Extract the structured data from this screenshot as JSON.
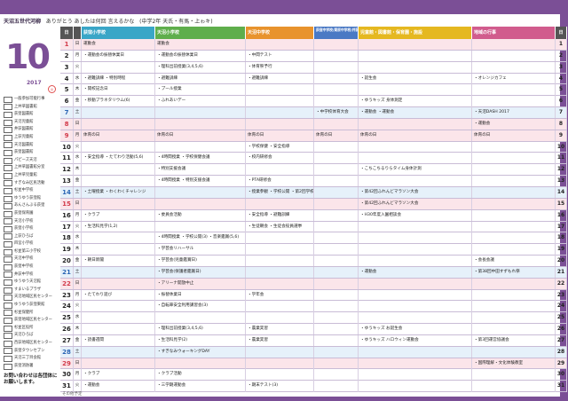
{
  "header": {
    "brand": "天沼五世代河柳",
    "greeting": "ありがとう あしたは何回 言えるかな",
    "note": "(中学2年 天氏・有馬・上ゎキ)"
  },
  "month": "10",
  "year": "2017",
  "legend": [
    {
      "sym": "",
      "label": "一般参加可能行事"
    },
    {
      "sym": "",
      "label": "上井草図書館"
    },
    {
      "sym": "",
      "label": "荻窪図書館"
    },
    {
      "sym": "",
      "label": "天沼児童館"
    },
    {
      "sym": "",
      "label": "井荻図書館"
    },
    {
      "sym": "",
      "label": "上荻児童館"
    },
    {
      "sym": "",
      "label": "天沼図書館"
    },
    {
      "sym": "",
      "label": "荻窪図書館"
    },
    {
      "sym": "",
      "label": "パピーズ天沼"
    },
    {
      "sym": "",
      "label": "上井草図書館分室"
    },
    {
      "sym": "",
      "label": "上井草児童館"
    },
    {
      "sym": "",
      "label": "すぎなみ区民活動"
    },
    {
      "sym": "",
      "label": "杉並中学校"
    },
    {
      "sym": "",
      "label": "ゆうゆう荻窪館"
    },
    {
      "sym": "",
      "label": "あんさんぶる荻窪"
    },
    {
      "sym": "",
      "label": "荻窪保育園"
    },
    {
      "sym": "",
      "label": "天沼小学校"
    },
    {
      "sym": "",
      "label": "荻窪小学校"
    },
    {
      "sym": "",
      "label": "上荻ひろば"
    },
    {
      "sym": "",
      "label": "四宮小学校"
    },
    {
      "sym": "",
      "label": "杉並第三小学校"
    },
    {
      "sym": "",
      "label": "天沼中学校"
    },
    {
      "sym": "",
      "label": "荻窪中学校"
    },
    {
      "sym": "",
      "label": "井荻中学校"
    },
    {
      "sym": "",
      "label": "ゆうゆう天沼館"
    },
    {
      "sym": "",
      "label": "すまいるプラザ"
    },
    {
      "sym": "",
      "label": "天沼地域区民センター"
    },
    {
      "sym": "",
      "label": "ゆうゆう荻窪東館"
    },
    {
      "sym": "",
      "label": "杉並保健所"
    },
    {
      "sym": "",
      "label": "荻窪地域区民センター"
    },
    {
      "sym": "",
      "label": "杉並区役所"
    },
    {
      "sym": "",
      "label": "天沼ひろば"
    },
    {
      "sym": "",
      "label": "西荻地域区民センター"
    },
    {
      "sym": "",
      "label": "荻窪タウンセブン"
    },
    {
      "sym": "",
      "label": "天沼三丁目会館"
    },
    {
      "sym": "",
      "label": "荻窪消防署"
    }
  ],
  "contact": "お問い合わせは各団体にお願いします。",
  "columns": [
    "日",
    "",
    "荻窪小学校",
    "天沼小学校",
    "天沼中学校",
    "荻窪中学校/東原中学校/井荻中学校",
    "児童館・図書館・保育園・施設",
    "地域の行事",
    "日"
  ],
  "days": [
    {
      "d": "1",
      "w": "日",
      "c1": "運動会",
      "c2": "運動会",
      "c3": "",
      "c4": "",
      "c5": "",
      "c6": "",
      "type": "sun"
    },
    {
      "d": "2",
      "w": "月",
      "c1": "・運動会の振替休業日",
      "c2": "・運動会の振替休業日",
      "c3": "・中間テスト",
      "c4": "",
      "c5": "",
      "c6": "",
      "type": ""
    },
    {
      "d": "3",
      "w": "火",
      "c1": "",
      "c2": "・理科出前授業(3,4,5,6)",
      "c3": "・体育祭予行",
      "c4": "",
      "c5": "",
      "c6": "",
      "type": ""
    },
    {
      "d": "4",
      "w": "水",
      "c1": "・避難訓練 ・特別時程",
      "c2": "・避難訓練",
      "c3": "・避難訓練",
      "c4": "",
      "c5": "・誕生会",
      "c6": "・オレンジカフェ",
      "type": ""
    },
    {
      "d": "5",
      "w": "木",
      "c1": "・開校記念日",
      "c2": "・プール授業",
      "c3": "",
      "c4": "",
      "c5": "",
      "c6": "",
      "type": ""
    },
    {
      "d": "6",
      "w": "金",
      "c1": "・移動プラネタリウム(6)",
      "c2": "・ふれあいデー",
      "c3": "",
      "c4": "",
      "c5": "・ゆうキッズ 身体測定",
      "c6": "",
      "type": ""
    },
    {
      "d": "7",
      "w": "土",
      "c1": "",
      "c2": "",
      "c3": "",
      "c4": "・中学校体育大会",
      "c5": "・運動会 ・運動会",
      "c6": "・天沼DASH 2017",
      "type": "sat"
    },
    {
      "d": "8",
      "w": "日",
      "c1": "",
      "c2": "",
      "c3": "",
      "c4": "",
      "c5": "",
      "c6": "・運動会",
      "type": "sun"
    },
    {
      "d": "9",
      "w": "月",
      "c1": "体育の日",
      "c2": "体育の日",
      "c3": "体育の日",
      "c4": "体育の日",
      "c5": "体育の日",
      "c6": "体育の日",
      "type": "sun"
    },
    {
      "d": "10",
      "w": "火",
      "c1": "",
      "c2": "",
      "c3": "・学校保健 ・安全指導",
      "c4": "",
      "c5": "",
      "c6": "",
      "type": ""
    },
    {
      "d": "11",
      "w": "水",
      "c1": "・安全指導 ・たてわり活動(5,6)",
      "c2": "・4時間授業 ・学校保健会議",
      "c3": "・校内研修会",
      "c4": "",
      "c5": "",
      "c6": "",
      "type": ""
    },
    {
      "d": "12",
      "w": "木",
      "c1": "",
      "c2": "・特別支援会議",
      "c3": "",
      "c4": "",
      "c5": "・こちこちるりらタイム身体計測",
      "c6": "",
      "type": ""
    },
    {
      "d": "13",
      "w": "金",
      "c1": "",
      "c2": "・4時間授業 ・特別支援会議",
      "c3": "・PTA研修会",
      "c4": "",
      "c5": "",
      "c6": "",
      "type": ""
    },
    {
      "d": "14",
      "w": "土",
      "c1": "・土曜授業 ・わくわくチャレンジ",
      "c2": "",
      "c3": "・授業参観 ・学校公開 ・第2回学校説明会",
      "c4": "",
      "c5": "・第42回ふれんどマラソン大会",
      "c6": "",
      "type": "sat"
    },
    {
      "d": "15",
      "w": "日",
      "c1": "",
      "c2": "",
      "c3": "",
      "c4": "",
      "c5": "・第42回ふれんどマラソン大会",
      "c6": "",
      "type": "sun"
    },
    {
      "d": "16",
      "w": "月",
      "c1": "・クラブ",
      "c2": "・委員会活動",
      "c3": "・安全指導 ・避難訓練",
      "c4": "",
      "c5": "・H30年度入園相談会",
      "c6": "",
      "type": ""
    },
    {
      "d": "17",
      "w": "火",
      "c1": "・生活科見学(1,2)",
      "c2": "",
      "c3": "・生徒朝会 ・生徒会役員選挙",
      "c4": "",
      "c5": "",
      "c6": "",
      "type": ""
    },
    {
      "d": "18",
      "w": "水",
      "c1": "",
      "c2": "・4時間授業 ・学校公開(3) ・音楽鑑賞(5,6)",
      "c3": "",
      "c4": "",
      "c5": "",
      "c6": "",
      "type": ""
    },
    {
      "d": "19",
      "w": "木",
      "c1": "",
      "c2": "・学芸会リハーサル",
      "c3": "",
      "c4": "",
      "c5": "",
      "c6": "",
      "type": ""
    },
    {
      "d": "20",
      "w": "金",
      "c1": "・朝日新聞",
      "c2": "・学芸会(児童鑑賞日)",
      "c3": "",
      "c4": "",
      "c5": "",
      "c6": "・会長会議",
      "type": ""
    },
    {
      "d": "21",
      "w": "土",
      "c1": "",
      "c2": "・学芸会(保護者鑑賞日)",
      "c3": "",
      "c4": "",
      "c5": "・運動会",
      "c6": "・第38回中田すずもれ祭",
      "type": "sat"
    },
    {
      "d": "22",
      "w": "日",
      "c1": "",
      "c2": "・アリーナ開放中止",
      "c3": "",
      "c4": "",
      "c5": "",
      "c6": "",
      "type": "sun"
    },
    {
      "d": "23",
      "w": "月",
      "c1": "・たてわり遊び",
      "c2": "・振替休業日",
      "c3": "・学年会",
      "c4": "",
      "c5": "",
      "c6": "",
      "type": ""
    },
    {
      "d": "24",
      "w": "火",
      "c1": "",
      "c2": "・自転車安全利用講習会(3)",
      "c3": "",
      "c4": "",
      "c5": "",
      "c6": "",
      "type": ""
    },
    {
      "d": "25",
      "w": "水",
      "c1": "",
      "c2": "",
      "c3": "",
      "c4": "",
      "c5": "",
      "c6": "",
      "type": ""
    },
    {
      "d": "26",
      "w": "木",
      "c1": "",
      "c2": "・理科出前授業(3,4,5,6)",
      "c3": "・農業実習",
      "c4": "",
      "c5": "・ゆうキッズ お誕生会",
      "c6": "",
      "type": ""
    },
    {
      "d": "27",
      "w": "金",
      "c1": "・読書週間",
      "c2": "・生活科見学(2)",
      "c3": "・農業実習",
      "c4": "",
      "c5": "・ゆうキッズ ハロウィン運動会",
      "c6": "・第3回運営協議会",
      "type": ""
    },
    {
      "d": "28",
      "w": "土",
      "c1": "",
      "c2": "・すぎなみウォーキングDAY",
      "c3": "",
      "c4": "",
      "c5": "",
      "c6": "",
      "type": "sat"
    },
    {
      "d": "29",
      "w": "日",
      "c1": "",
      "c2": "",
      "c3": "",
      "c4": "",
      "c5": "",
      "c6": "・国際理解・文化体験教室",
      "type": "sun"
    },
    {
      "d": "30",
      "w": "月",
      "c1": "・クラブ",
      "c2": "・クラブ活動",
      "c3": "",
      "c4": "",
      "c5": "",
      "c6": "",
      "type": ""
    },
    {
      "d": "31",
      "w": "火",
      "c1": "・運動会",
      "c2": "・三学期運動会",
      "c3": "・期末テスト(3)",
      "c4": "",
      "c5": "",
      "c6": "",
      "type": ""
    }
  ],
  "footnote": "その他予定"
}
